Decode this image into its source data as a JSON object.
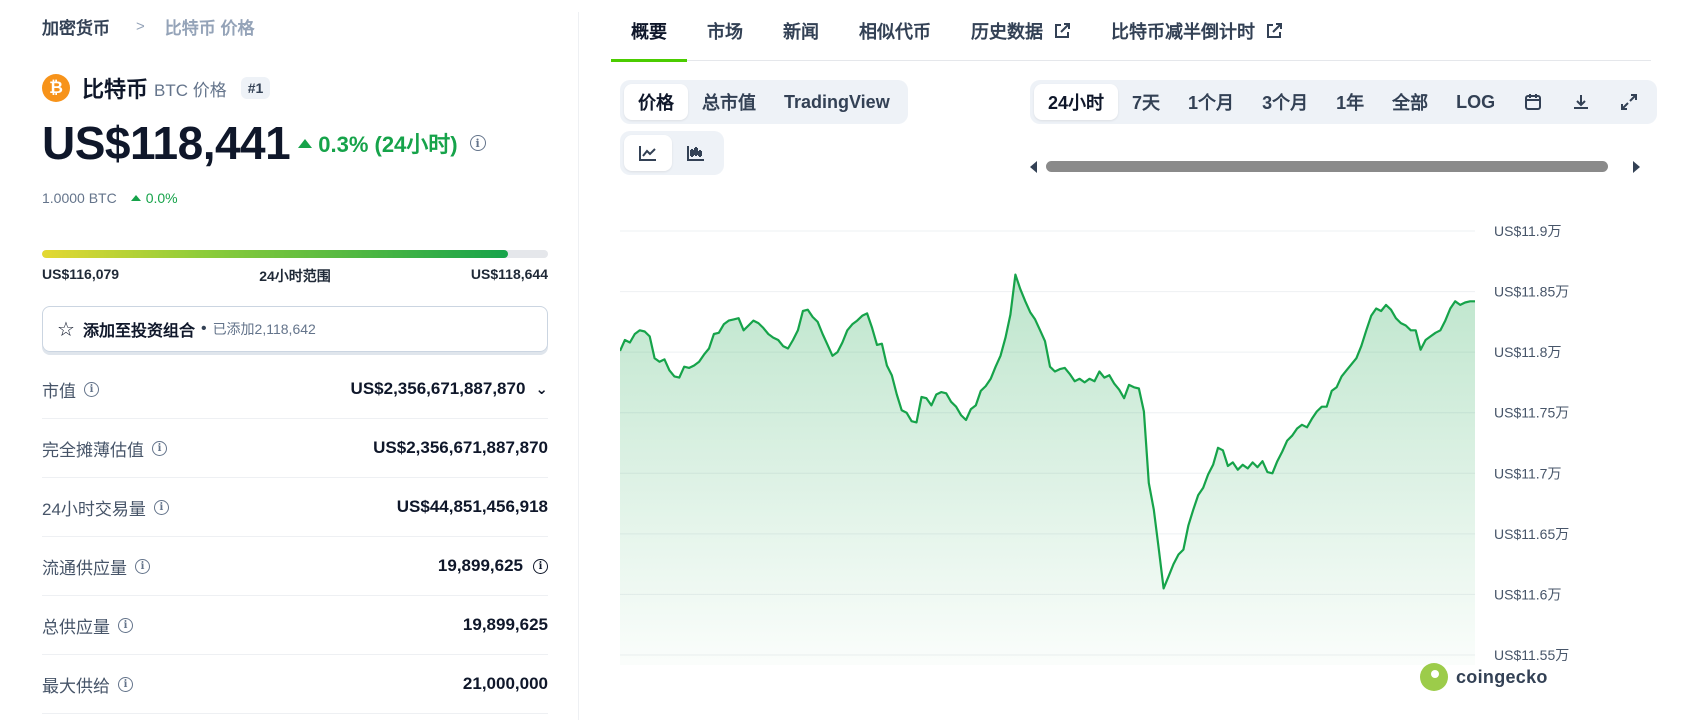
{
  "breadcrumb": {
    "root": "加密货币",
    "current": "比特币 价格"
  },
  "coin": {
    "name": "比特币",
    "symbol_label": "BTC 价格",
    "rank": "#1",
    "logo_glyph": "₿",
    "logo_color": "#f7931a"
  },
  "price": {
    "value": "US$118,441",
    "change": "0.3% (24小时)",
    "btc_value": "1.0000 BTC",
    "btc_change": "0.0%"
  },
  "range_24h": {
    "low": "US$116,079",
    "label": "24小时范围",
    "high": "US$118,644",
    "position_pct": 92
  },
  "watchlist": {
    "label": "添加至投资组合",
    "dot": "•",
    "count": "已添加2,118,642"
  },
  "stats": [
    {
      "label": "市值",
      "value": "US$2,356,671,887,870"
    },
    {
      "label": "完全摊薄估值",
      "value": "US$2,356,671,887,870"
    },
    {
      "label": "24小时交易量",
      "value": "US$44,851,456,918"
    },
    {
      "label": "流通供应量",
      "value": "19,899,625"
    },
    {
      "label": "总供应量",
      "value": "19,899,625"
    },
    {
      "label": "最大供给",
      "value": "21,000,000"
    }
  ],
  "tabs": [
    "概要",
    "市场",
    "新闻",
    "相似代币",
    "历史数据",
    "比特币减半倒计时"
  ],
  "chart_type_buttons": [
    "价格",
    "总市值",
    "TradingView"
  ],
  "range_buttons": [
    "24小时",
    "7天",
    "1个月",
    "3个月",
    "1年",
    "全部",
    "LOG"
  ],
  "watermark": "coingecko",
  "colors": {
    "accent": "#4bcc00",
    "up": "#16a34a",
    "line": "#16a34a"
  },
  "chart_data": {
    "type": "area",
    "y_unit_suffix": "万",
    "ylim": [
      11.55,
      11.9
    ],
    "yticks": [
      "US$11.9万",
      "US$11.85万",
      "US$11.8万",
      "US$11.75万",
      "US$11.7万",
      "US$11.65万",
      "US$11.6万",
      "US$11.55万"
    ],
    "grid": true,
    "values": [
      11.801,
      11.81,
      11.808,
      11.815,
      11.818,
      11.817,
      11.813,
      11.795,
      11.792,
      11.794,
      11.785,
      11.78,
      11.779,
      11.788,
      11.787,
      11.789,
      11.792,
      11.798,
      11.803,
      11.815,
      11.816,
      11.823,
      11.826,
      11.827,
      11.828,
      11.818,
      11.822,
      11.826,
      11.824,
      11.82,
      11.815,
      11.812,
      11.81,
      11.805,
      11.803,
      11.81,
      11.818,
      11.834,
      11.835,
      11.829,
      11.825,
      11.815,
      11.806,
      11.797,
      11.8,
      11.808,
      11.818,
      11.823,
      11.826,
      11.83,
      11.832,
      11.82,
      11.806,
      11.807,
      11.789,
      11.781,
      11.765,
      11.752,
      11.75,
      11.743,
      11.742,
      11.763,
      11.762,
      11.756,
      11.765,
      11.767,
      11.766,
      11.759,
      11.755,
      11.748,
      11.744,
      11.753,
      11.756,
      11.768,
      11.772,
      11.778,
      11.788,
      11.797,
      11.812,
      11.831,
      11.864,
      11.852,
      11.842,
      11.833,
      11.827,
      11.818,
      11.809,
      11.788,
      11.784,
      11.786,
      11.787,
      11.782,
      11.776,
      11.778,
      11.775,
      11.778,
      11.776,
      11.784,
      11.779,
      11.781,
      11.774,
      11.769,
      11.762,
      11.773,
      11.771,
      11.77,
      11.751,
      11.692,
      11.67,
      11.638,
      11.605,
      11.615,
      11.625,
      11.633,
      11.637,
      11.657,
      11.67,
      11.682,
      11.688,
      11.699,
      11.707,
      11.721,
      11.719,
      11.706,
      11.709,
      11.703,
      11.707,
      11.704,
      11.709,
      11.705,
      11.71,
      11.701,
      11.7,
      11.71,
      11.718,
      11.727,
      11.731,
      11.737,
      11.74,
      11.738,
      11.745,
      11.751,
      11.755,
      11.755,
      11.768,
      11.771,
      11.78,
      11.785,
      11.79,
      11.795,
      11.805,
      11.818,
      11.83,
      11.836,
      11.834,
      11.839,
      11.835,
      11.828,
      11.824,
      11.822,
      11.818,
      11.818,
      11.802,
      11.81,
      11.813,
      11.816,
      11.818,
      11.826,
      11.836,
      11.842,
      11.839,
      11.841,
      11.842,
      11.842
    ]
  }
}
